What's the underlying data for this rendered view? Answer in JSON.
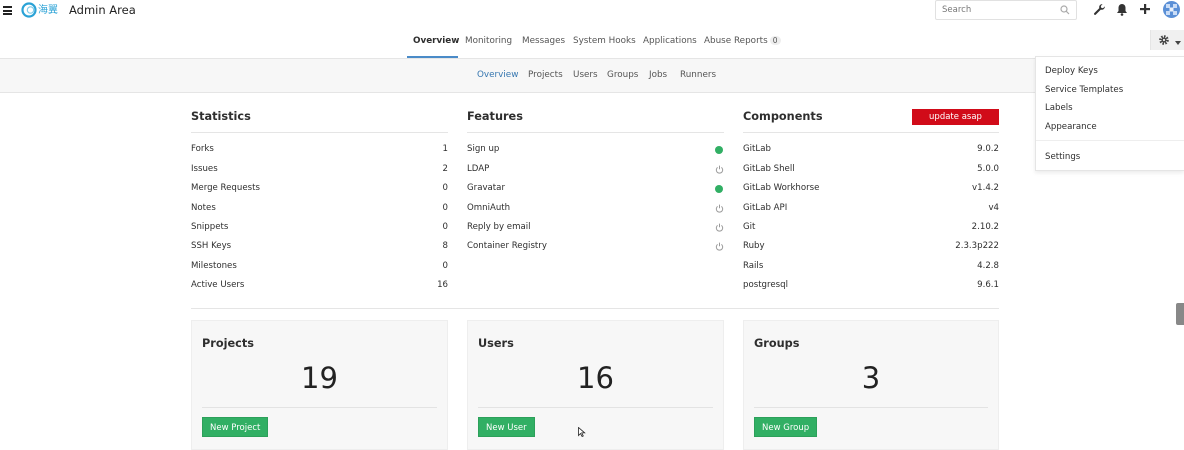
{
  "header": {
    "logo_text": "海翼",
    "title": "Admin Area",
    "search_placeholder": "Search",
    "icons": [
      "menu-icon",
      "search-icon",
      "wrench-icon",
      "bell-icon",
      "plus-icon",
      "avatar"
    ]
  },
  "nav": {
    "tabs": [
      {
        "label": "Overview"
      },
      {
        "label": "Monitoring"
      },
      {
        "label": "Messages"
      },
      {
        "label": "System Hooks"
      },
      {
        "label": "Applications"
      },
      {
        "label": "Abuse Reports",
        "badge": "0"
      }
    ],
    "active_tab": "Overview"
  },
  "subnav": {
    "tabs": [
      {
        "label": "Overview"
      },
      {
        "label": "Projects"
      },
      {
        "label": "Users"
      },
      {
        "label": "Groups"
      },
      {
        "label": "Jobs"
      },
      {
        "label": "Runners"
      }
    ],
    "active_tab": "Overview"
  },
  "statistics": {
    "title": "Statistics",
    "rows": [
      {
        "label": "Forks",
        "value": "1"
      },
      {
        "label": "Issues",
        "value": "2"
      },
      {
        "label": "Merge Requests",
        "value": "0"
      },
      {
        "label": "Notes",
        "value": "0"
      },
      {
        "label": "Snippets",
        "value": "0"
      },
      {
        "label": "SSH Keys",
        "value": "8"
      },
      {
        "label": "Milestones",
        "value": "0"
      },
      {
        "label": "Active Users",
        "value": "16"
      }
    ]
  },
  "features": {
    "title": "Features",
    "rows": [
      {
        "label": "Sign up",
        "enabled": true
      },
      {
        "label": "LDAP",
        "enabled": false
      },
      {
        "label": "Gravatar",
        "enabled": true
      },
      {
        "label": "OmniAuth",
        "enabled": false
      },
      {
        "label": "Reply by email",
        "enabled": false
      },
      {
        "label": "Container Registry",
        "enabled": false
      }
    ]
  },
  "components": {
    "title": "Components",
    "update_label": "update asap",
    "rows": [
      {
        "label": "GitLab",
        "value": "9.0.2"
      },
      {
        "label": "GitLab Shell",
        "value": "5.0.0"
      },
      {
        "label": "GitLab Workhorse",
        "value": "v1.4.2"
      },
      {
        "label": "GitLab API",
        "value": "v4"
      },
      {
        "label": "Git",
        "value": "2.10.2"
      },
      {
        "label": "Ruby",
        "value": "2.3.3p222"
      },
      {
        "label": "Rails",
        "value": "4.2.8"
      },
      {
        "label": "postgresql",
        "value": "9.6.1"
      }
    ]
  },
  "cards": [
    {
      "title": "Projects",
      "count": "19",
      "button": "New Project"
    },
    {
      "title": "Users",
      "count": "16",
      "button": "New User"
    },
    {
      "title": "Groups",
      "count": "3",
      "button": "New Group"
    }
  ],
  "settings_menu": {
    "items": [
      "Deploy Keys",
      "Service Templates",
      "Labels",
      "Appearance",
      "Settings"
    ]
  },
  "colors": {
    "accent": "#4a8bc8",
    "link_active": "#3777b0",
    "success": "#31af64",
    "danger": "#d10b19"
  }
}
